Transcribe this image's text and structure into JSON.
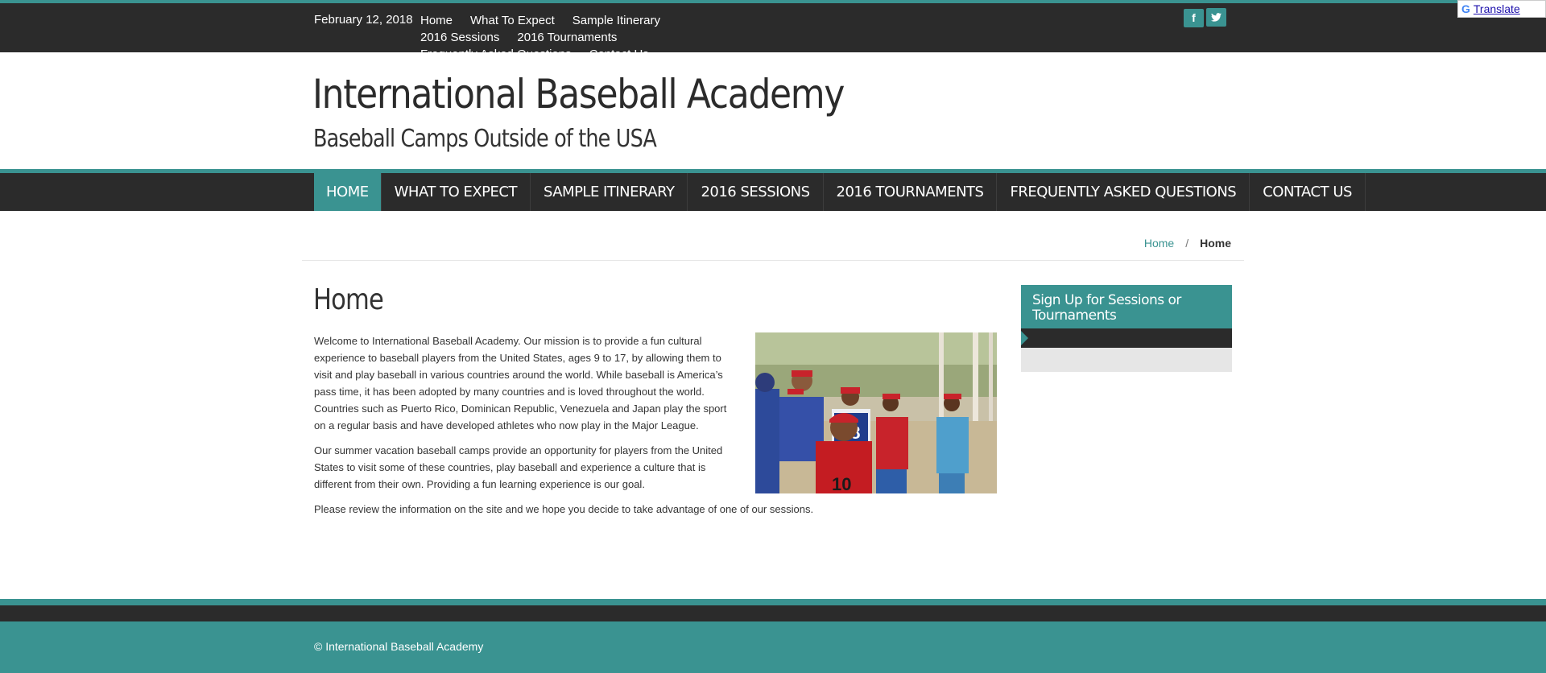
{
  "topbar": {
    "date": "February 12, 2018",
    "links": [
      "Home",
      "What To Expect",
      "Sample Itinerary",
      "2016 Sessions",
      "2016 Tournaments",
      "Frequently Asked Questions",
      "Contact Us"
    ],
    "social": {
      "facebook": "f",
      "twitter": "t"
    }
  },
  "translate": {
    "label": "Translate"
  },
  "site": {
    "title": "International Baseball Academy",
    "tagline": "Baseball Camps Outside of the USA"
  },
  "mainnav": {
    "items": [
      "HOME",
      "WHAT TO EXPECT",
      "SAMPLE ITINERARY",
      "2016 SESSIONS",
      "2016 TOURNAMENTS",
      "FREQUENTLY ASKED QUESTIONS",
      "CONTACT US"
    ]
  },
  "breadcrumb": {
    "home": "Home",
    "separator": "/",
    "current": "Home"
  },
  "page": {
    "heading": "Home",
    "paragraphs": [
      "Welcome to International Baseball Academy.  Our mission is to provide a fun cultural experience to baseball players from the United States, ages 9 to 17, by allowing them to visit and play baseball in various countries around the world. While baseball is America’s pass time, it has been adopted by many countries and is loved throughout the world.  Countries such as Puerto Rico, Dominican Republic, Venezuela and Japan play the sport on a regular basis and have developed athletes who now play in the Major League.",
      "Our summer vacation baseball camps provide an opportunity for players from the United States to visit some of these countries, play baseball and experience a culture that is different from their own.  Providing a fun learning experience is our goal.",
      "Please review the information on the site and we hope you decide to take advantage of one of our sessions."
    ]
  },
  "sidebar": {
    "widget_title": "Sign Up for Sessions or Tournaments"
  },
  "footer": {
    "copyright": "© International Baseball Academy"
  },
  "colors": {
    "accent": "#3a9391",
    "dark": "#2b2b2b"
  }
}
